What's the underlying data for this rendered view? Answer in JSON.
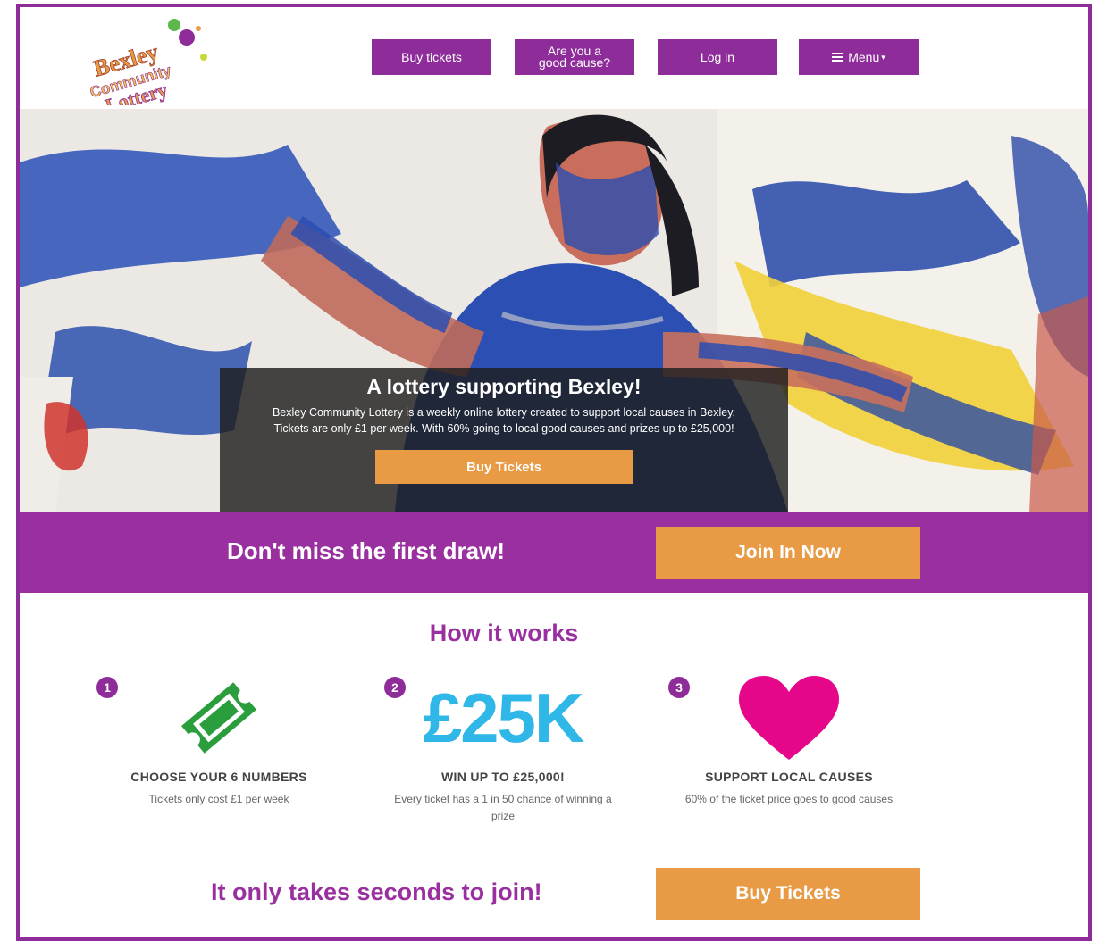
{
  "brand": {
    "logo_line1": "Bexley",
    "logo_line2": "Community",
    "logo_line3": "Lottery"
  },
  "nav": {
    "buy_tickets": "Buy tickets",
    "good_cause_line1": "Are you a",
    "good_cause_line2": "good cause?",
    "log_in": "Log in",
    "menu": "Menu",
    "menu_caret": "▾"
  },
  "hero": {
    "title": "A lottery supporting Bexley!",
    "text_line1": "Bexley Community Lottery is a weekly online lottery created to support local causes in Bexley.",
    "text_line2": "Tickets are only £1 per week. With 60% going to local good causes and prizes up to £25,000!",
    "cta": "Buy Tickets"
  },
  "band": {
    "text": "Don't miss the first draw!",
    "button": "Join In Now"
  },
  "how": {
    "title": "How it works",
    "steps": [
      {
        "num": "1",
        "heading": "CHOOSE YOUR 6 NUMBERS",
        "desc": "Tickets only cost £1 per week",
        "icon": "ticket-icon"
      },
      {
        "num": "2",
        "big": "£25K",
        "heading": "WIN UP TO £25,000!",
        "desc": "Every ticket has a 1 in 50 chance of winning a prize"
      },
      {
        "num": "3",
        "heading": "SUPPORT LOCAL CAUSES",
        "desc": "60% of the ticket price goes to good causes",
        "icon": "heart-icon"
      }
    ]
  },
  "footer_cta": {
    "text": "It only takes seconds to join!",
    "button": "Buy Tickets"
  },
  "colors": {
    "purple": "#9a30a0",
    "orange": "#e89a45",
    "blue": "#2fb7e8",
    "green": "#2a9e3c",
    "pink": "#e6068a"
  }
}
